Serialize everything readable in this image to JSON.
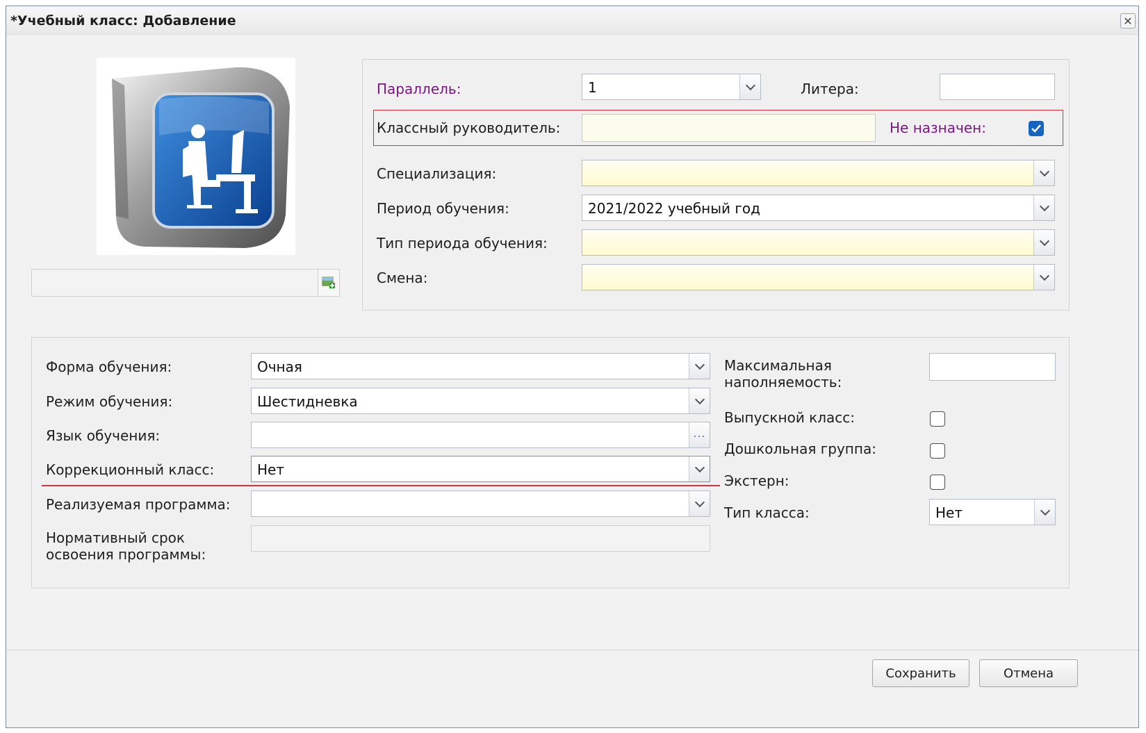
{
  "window": {
    "title": "*Учебный класс: Добавление",
    "close_glyph": "✕"
  },
  "icons": {
    "close": "close-icon",
    "class_image": "student-at-desk-icon",
    "image_upload": "add-image-icon",
    "dropdown": "chevron-down-icon",
    "lookup": "ellipsis-icon",
    "checkmark": "checkmark-icon"
  },
  "colors": {
    "required_label": "#7a1780",
    "highlight": "#d0343c",
    "checkbox_checked": "#1565c0",
    "required_field": "#fffbd2"
  },
  "top_form": {
    "parallel": {
      "label": "Параллель:",
      "value": "1"
    },
    "litera": {
      "label": "Литера:",
      "value": ""
    },
    "class_teacher": {
      "label": "Классный руководитель:",
      "value": ""
    },
    "not_assigned": {
      "label": "Не назначен:",
      "checked": true
    },
    "specialization": {
      "label": "Специализация:",
      "value": ""
    },
    "study_period": {
      "label": "Период обучения:",
      "value": "2021/2022 учебный год"
    },
    "study_period_type": {
      "label": "Тип периода обучения:",
      "value": ""
    },
    "shift": {
      "label": "Смена:",
      "value": ""
    }
  },
  "bottom_form": {
    "education_form": {
      "label": "Форма обучения:",
      "value": "Очная"
    },
    "education_mode": {
      "label": "Режим обучения:",
      "value": "Шестидневка"
    },
    "education_language": {
      "label": "Язык обучения:",
      "value": ""
    },
    "correctional_class": {
      "label": "Коррекционный класс:",
      "value": "Нет"
    },
    "program": {
      "label": "Реализуемая программа:",
      "value": ""
    },
    "normative_term": {
      "label": "Нормативный срок освоения программы:",
      "value": ""
    },
    "max_capacity": {
      "label": "Максимальная наполняемость:",
      "value": ""
    },
    "graduation_class": {
      "label": "Выпускной класс:",
      "checked": false
    },
    "preschool_group": {
      "label": "Дошкольная группа:",
      "checked": false
    },
    "extern": {
      "label": "Экстерн:",
      "checked": false
    },
    "class_type": {
      "label": "Тип класса:",
      "value": "Нет"
    }
  },
  "buttons": {
    "save": "Сохранить",
    "cancel": "Отмена"
  }
}
